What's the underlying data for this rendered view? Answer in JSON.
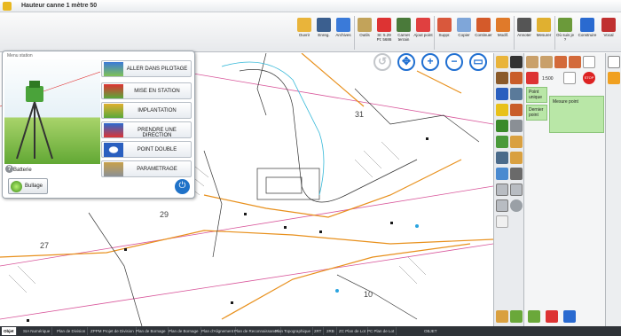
{
  "window": {
    "title": "Hauteur canne 1 mètre 50"
  },
  "ribbon": {
    "groups": [
      {
        "buttons": [
          {
            "label": "Ouvrir",
            "icon": "folder-open-icon",
            "color": "#e9b43a"
          },
          {
            "label": "Enreg.",
            "icon": "save-icon",
            "color": "#3b5f8f"
          },
          {
            "label": "Archives",
            "icon": "undo-archive-icon",
            "color": "#3a7ad9"
          }
        ]
      },
      {
        "buttons": [
          {
            "label": "Outils",
            "icon": "tools-icon",
            "color": "#c2a35a"
          },
          {
            "label": "St: 5.29 Pt: 5686",
            "icon": "station-icon",
            "color": "#d33"
          },
          {
            "label": "Carnet terrain",
            "icon": "field-book-icon",
            "color": "#4a7a3a"
          },
          {
            "label": "Ajout point",
            "icon": "add-point-icon",
            "color": "#e04040"
          }
        ]
      },
      {
        "buttons": [
          {
            "label": "Suppr.",
            "icon": "eraser-icon",
            "color": "#d9583c"
          },
          {
            "label": "Copier",
            "icon": "copy-icon",
            "color": "#7fa6d9"
          },
          {
            "label": "Continuer",
            "icon": "continue-icon",
            "color": "#d45a2a"
          },
          {
            "label": "Modif.",
            "icon": "modify-icon",
            "color": "#e07a2a"
          }
        ]
      },
      {
        "buttons": [
          {
            "label": "Annoter",
            "icon": "annotate-icon",
            "color": "#555"
          },
          {
            "label": "Mesurer",
            "icon": "ruler-icon",
            "color": "#e0b030"
          }
        ]
      },
      {
        "buttons": [
          {
            "label": "Où suis je ?",
            "icon": "where-am-i-icon",
            "color": "#6b9a3a"
          },
          {
            "label": "Construire",
            "icon": "construct-icon",
            "color": "#2a6ad0"
          },
          {
            "label": "Vocal",
            "icon": "microphone-icon",
            "color": "#c03030"
          }
        ]
      }
    ]
  },
  "station_panel": {
    "title": "Menu station",
    "buttons": [
      {
        "label": "ALLER DANS PILOTAGE",
        "icon": "pilotage-icon"
      },
      {
        "label": "MISE EN STATION",
        "icon": "station-setup-icon"
      },
      {
        "label": "IMPLANTATION",
        "icon": "stakeout-icon"
      },
      {
        "label": "PRENDRE UNE DIRECTION",
        "icon": "direction-icon"
      },
      {
        "label": "POINT DOUBLE",
        "icon": "double-point-icon"
      },
      {
        "label": "PARAMETRAGE",
        "icon": "settings-tools-icon"
      }
    ],
    "battery_label": "Batterie",
    "bullage_label": "Bullage"
  },
  "right_panel": {
    "scale": "1:500",
    "point_unique": "Point unique",
    "dernier_point": "Dernier point",
    "mesure_point": "Mesure point",
    "stop": "STOP"
  },
  "map_labels": [
    "31",
    "29",
    "27",
    "10"
  ],
  "statusbar": {
    "tabs": [
      "Objet",
      "SIA Numérique",
      "Plan de Division",
      "ZPPM Projet de Division",
      "Plan de Bornage",
      "Plan de Bornage",
      "Plan d'Alignement",
      "Plan de Reconnaissance",
      "Plan Topographique",
      "2RT",
      "2RB",
      "ZC Plan de Lot",
      "PC Plan de Lot"
    ],
    "active_index": 0,
    "right_text": "OBJET"
  }
}
